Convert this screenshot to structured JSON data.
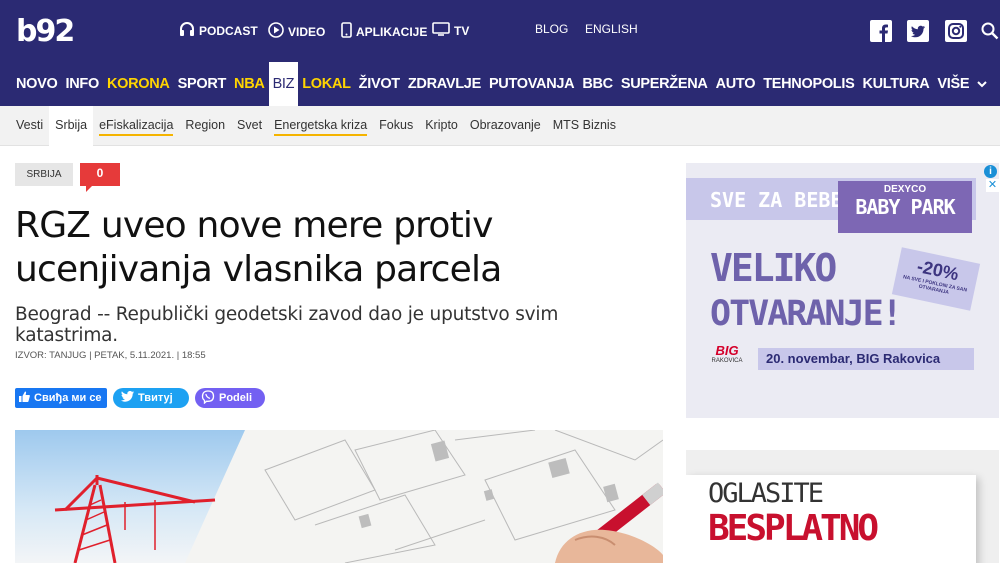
{
  "logo": "b92",
  "topnav": {
    "podcast": "PODCAST",
    "video": "VIDEO",
    "apps": "APLIKACIJE",
    "tv": "TV",
    "blog": "BLOG",
    "english": "ENGLISH"
  },
  "mainnav": [
    "NOVO",
    "INFO",
    "KORONA",
    "SPORT",
    "NBA",
    "BIZ",
    "LOKAL",
    "ŽIVOT",
    "ZDRAVLJE",
    "PUTOVANJA",
    "BBC",
    "SUPERŽENA",
    "AUTO",
    "TEHNOPOLIS",
    "KULTURA",
    "VIŠE"
  ],
  "subnav": [
    "Vesti",
    "Srbija",
    "eFiskalizacija",
    "Region",
    "Svet",
    "Energetska kriza",
    "Fokus",
    "Kripto",
    "Obrazovanje",
    "MTS Biznis"
  ],
  "article": {
    "tag": "SRBIJA",
    "comments": "0",
    "title": "RGZ uveo nove mere protiv ucenjivanja vlasnika parcela",
    "lead": "Beograd -- Republički geodetski zavod dao je uputstvo svim katastrima.",
    "meta": "IZVOR: TANJUG | PETAK, 5.11.2021. | 18:55"
  },
  "share": {
    "facebook": "Свиђа ми се",
    "twitter": "Твитуј",
    "viber": "Podeli"
  },
  "ad1": {
    "headline": "SVE ZA BEBE!",
    "brand_small": "DEXYCO",
    "brand": "BABY PARK",
    "line1": "VELIKO",
    "line2": "OTVARANJE!",
    "discount": "-20%",
    "discount_note": "NA SVE I POKLONI ZA SAN OTVARANJA",
    "store_logo": "BIG",
    "store_sub": "RAKOVICA",
    "date": "20. novembar, BIG Rakovica"
  },
  "ad2": {
    "line1": "OGLASITE",
    "line2": "BESPLATNO"
  },
  "colors": {
    "nav_bg": "#2b2a73",
    "accent_yellow": "#ffd400",
    "comment_red": "#e63a3a",
    "ad_purple": "#6e62ab"
  }
}
